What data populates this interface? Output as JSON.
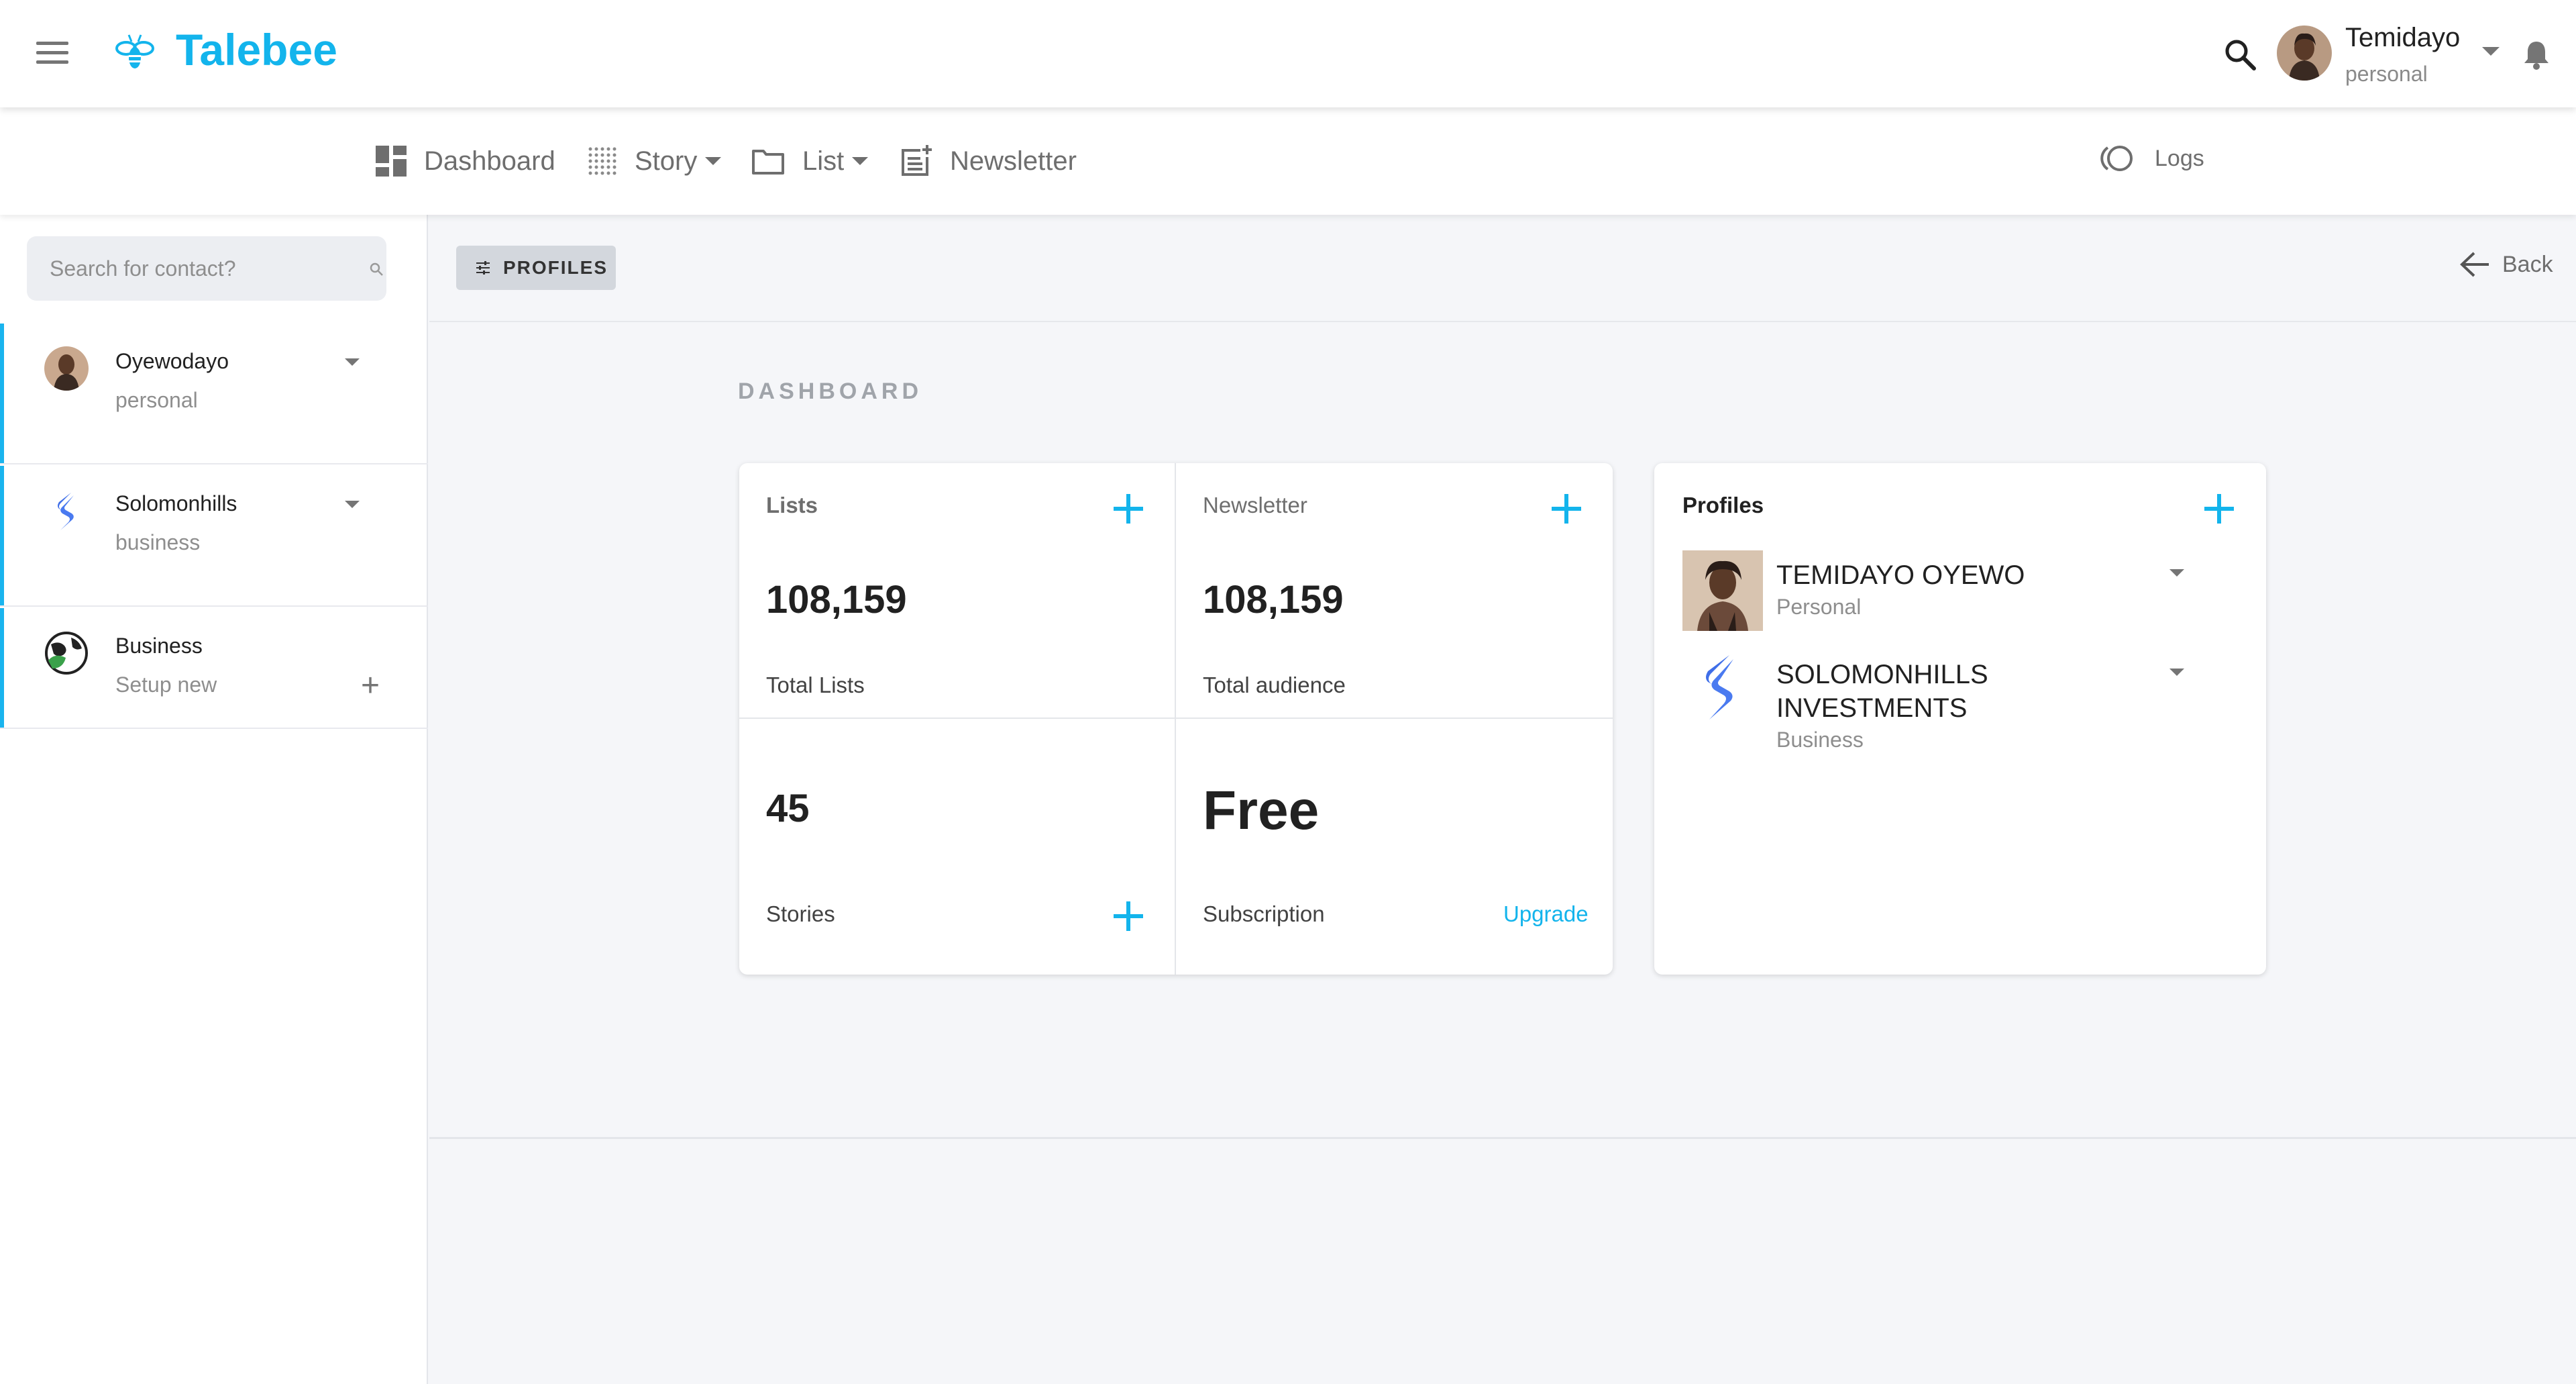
{
  "app": {
    "name": "Talebee",
    "brand_color": "#13b4ec"
  },
  "header": {
    "menu_icon": "hamburger-icon",
    "search_icon": "search-icon",
    "user": {
      "name": "Temidayo",
      "subtitle": "personal"
    },
    "notification_icon": "bell-icon"
  },
  "nav": {
    "items": [
      {
        "label": "Dashboard",
        "icon": "dashboard-icon"
      },
      {
        "label": "Story",
        "icon": "grid-dots-icon",
        "has_dropdown": true
      },
      {
        "label": "List",
        "icon": "folder-icon",
        "has_dropdown": true
      },
      {
        "label": "Newsletter",
        "icon": "newsletter-add-icon"
      }
    ],
    "logs": {
      "label": "Logs",
      "icon": "toggle-icon"
    }
  },
  "sidebar": {
    "search_placeholder": "Search for contact?",
    "contacts": [
      {
        "name": "Oyewodayo",
        "subtitle": "personal",
        "avatar": "person-avatar"
      },
      {
        "name": "Solomonhills",
        "subtitle": "business",
        "avatar": "solomonhills-logo"
      },
      {
        "name": "Business",
        "subtitle": "Setup new",
        "avatar": "globe-leaf-icon"
      }
    ]
  },
  "main": {
    "profiles_button": "PROFILES",
    "back_label": "Back",
    "section_title": "DASHBOARD",
    "stats": {
      "lists": {
        "title": "Lists",
        "value": "108,159",
        "caption": "Total Lists"
      },
      "newsletter": {
        "title": "Newsletter",
        "value": "108,159",
        "caption": "Total audience"
      },
      "stories": {
        "value": "45",
        "caption": "Stories"
      },
      "subscription": {
        "value": "Free",
        "caption": "Subscription",
        "action": "Upgrade"
      }
    },
    "profiles": {
      "title": "Profiles",
      "items": [
        {
          "name": "TEMIDAYO OYEWO",
          "type": "Personal"
        },
        {
          "name": "SOLOMONHILLS INVESTMENTS",
          "type": "Business"
        }
      ]
    }
  }
}
